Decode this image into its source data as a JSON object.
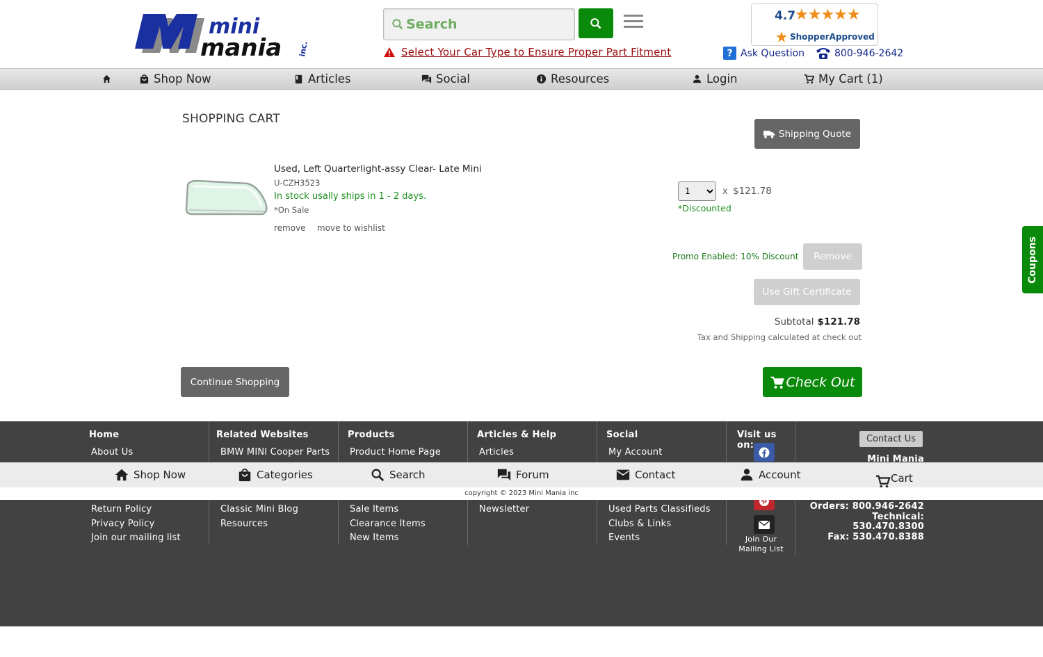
{
  "header": {
    "logo_text_line1": "mini",
    "logo_text_line2": "mania",
    "logo_text_inc": "inc.",
    "search_placeholder": "Search",
    "fitment_text": "Select Your Car Type to Ensure Proper Part Fitment",
    "rating_score": "4.7",
    "rating_stars": "★★★★★",
    "rating_brand": "ShopperApproved",
    "ask_question": "Ask Question",
    "ask_icon_text": "?",
    "phone": "800-946-2642"
  },
  "nav": {
    "shop_now": "Shop Now",
    "articles": "Articles",
    "social": "Social",
    "resources": "Resources",
    "login": "Login",
    "my_cart": "My Cart (1)"
  },
  "cart": {
    "title": "SHOPPING CART",
    "shipping_quote": "Shipping Quote",
    "item": {
      "name": "Used, Left Quarterlight-assy Clear- Late Mini",
      "sku": "U-CZH3523",
      "stock": "In stock usally ships in 1 - 2 days.",
      "sale": "*On Sale",
      "remove": "remove",
      "move_to_wishlist": "move to wishlist",
      "quantity": "1",
      "times": "x",
      "price": "$121.78",
      "discounted": "*Discounted"
    },
    "promo_text": "Promo Enabled:  10% Discount",
    "promo_remove": "Remove",
    "gift_certificate": "Use Gift Certificate",
    "subtotal_label": "Subtotal",
    "subtotal_value": "$121.78",
    "tax_note": "Tax and Shipping calculated at check out",
    "continue_shopping": "Continue Shopping",
    "check_out": "Check Out"
  },
  "coupons_tab": "Coupons",
  "footer": {
    "home": {
      "heading": "Home",
      "links": [
        "About Us",
        "Return Policy",
        "Privacy Policy",
        "Join our mailing list"
      ]
    },
    "related": {
      "heading": "Related Websites",
      "links": [
        "BMW MINI Cooper Parts",
        "Classic Mini Blog",
        "Resources"
      ]
    },
    "products": {
      "heading": "Products",
      "links": [
        "Product Home Page",
        "Sale Items",
        "Clearance Items",
        "New Items"
      ]
    },
    "articles": {
      "heading": "Articles & Help",
      "links": [
        "Articles",
        "Newsletter"
      ]
    },
    "social": {
      "heading": "Social",
      "links": [
        "My Account",
        "Used Parts Classifieds",
        "Clubs & Links",
        "Events"
      ]
    },
    "visit": {
      "heading": "Visit us on:",
      "join_line1": "Join Our",
      "join_line2": "Mailing List"
    },
    "contact": {
      "button": "Contact Us",
      "company": "Mini Mania",
      "orders": "Orders: 800.946-2642",
      "technical_label": "Technical:",
      "technical_value": "530.470.8300",
      "fax": "Fax: 530.470.8388"
    }
  },
  "bottom_nav": {
    "shop_now": "Shop Now",
    "categories": "Categories",
    "search": "Search",
    "forum": "Forum",
    "contact": "Contact",
    "account": "Account",
    "cart": "Cart"
  },
  "copyright": "copyright © 2023 Mini Mania inc",
  "colors": {
    "brand_blue": "#1a2fa0",
    "brand_green": "#0a8a0a",
    "alert_red": "#9b0d0d",
    "footer_bg": "#424242"
  }
}
